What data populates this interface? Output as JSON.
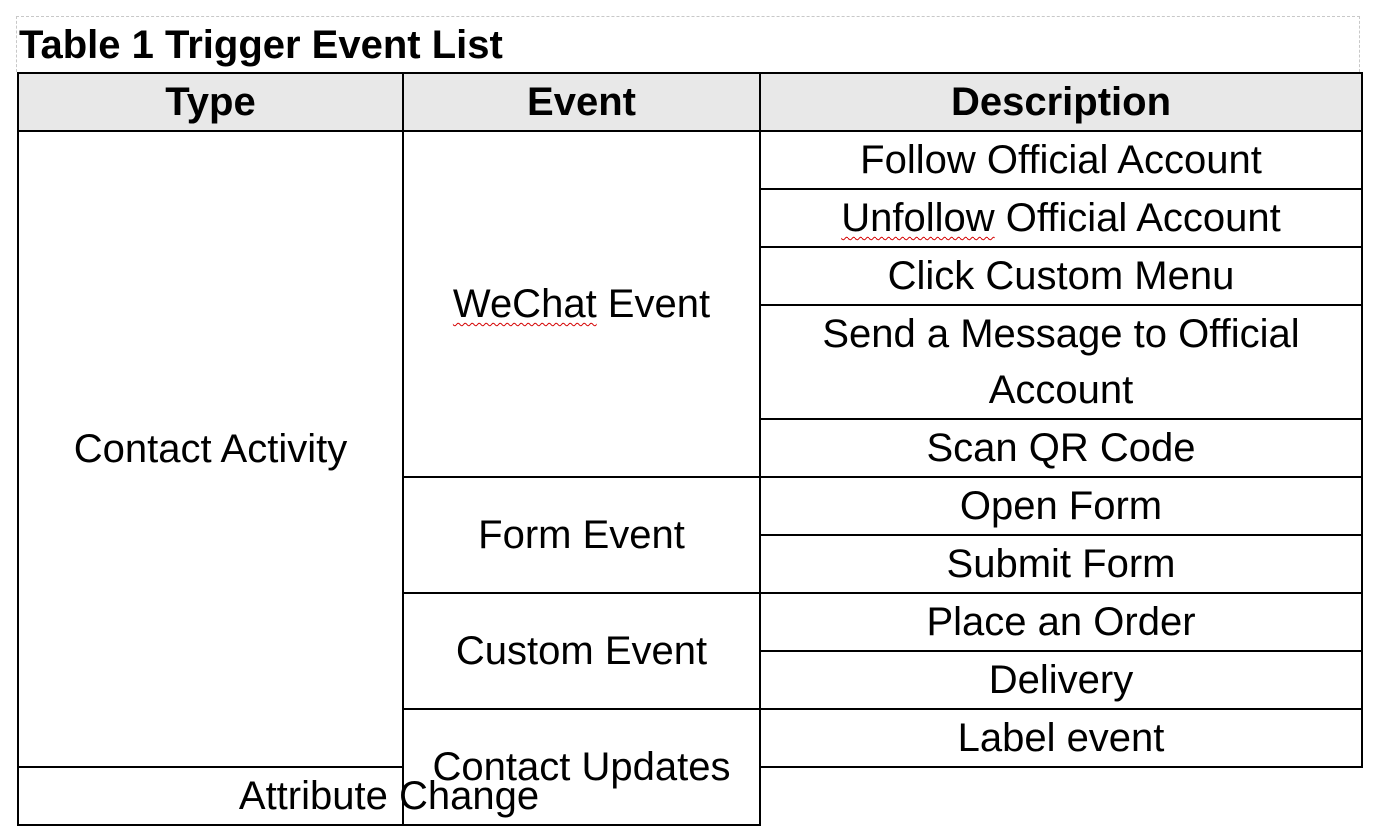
{
  "caption": "Table 1 Trigger Event List",
  "headers": {
    "type": "Type",
    "event": "Event",
    "description": "Description"
  },
  "groups": {
    "contact_activity": {
      "type": "Contact Activity",
      "wechat": {
        "event_prefix": "WeChat",
        "event_suffix": " Event",
        "desc_follow": "Follow Official Account",
        "desc_unfollow_word": "Unfollow",
        "desc_unfollow_rest": " Official Account",
        "desc_click_menu": "Click Custom Menu",
        "desc_send_message": "Send a Message to Official Account",
        "desc_scan_qr": "Scan QR Code"
      },
      "form": {
        "event": "Form Event",
        "desc_open": "Open Form",
        "desc_submit": "Submit Form"
      },
      "custom": {
        "event": "Custom Event",
        "desc_order": "Place an Order",
        "desc_delivery": "Delivery"
      }
    },
    "contact_updates": {
      "type": "Contact Updates",
      "label_event": "Label event",
      "attribute_change": "Attribute Change"
    }
  }
}
